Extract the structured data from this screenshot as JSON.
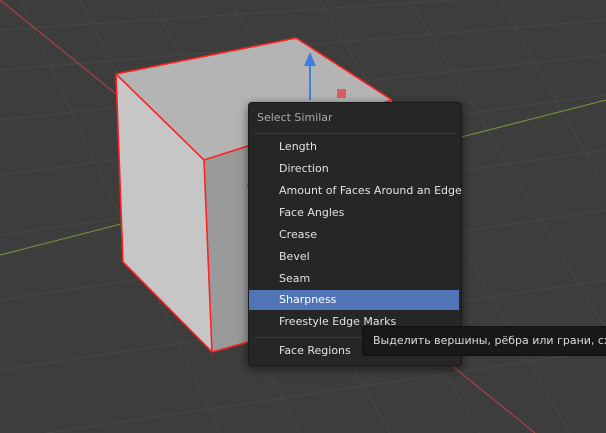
{
  "menu": {
    "title": "Select Similar",
    "items": [
      {
        "label": "Length"
      },
      {
        "label": "Direction"
      },
      {
        "label": "Amount of Faces Around an Edge"
      },
      {
        "label": "Face Angles"
      },
      {
        "label": "Crease"
      },
      {
        "label": "Bevel"
      },
      {
        "label": "Seam"
      },
      {
        "label": "Sharpness",
        "active": true
      },
      {
        "label": "Freestyle Edge Marks"
      },
      {
        "label": "Face Regions"
      }
    ]
  },
  "tooltip": {
    "text": "Выделить вершины, рёбра или грани, схож"
  },
  "colors": {
    "viewport_bg": "#3d3d3d",
    "grid": "#474747",
    "axis_x": "#c0404a",
    "axis_y": "#7a9a35",
    "cube_face": "#9a9a9a",
    "selection_edge": "#ff2020",
    "gizmo_arrow": "#3d7fe0",
    "menu_bg": "#262626",
    "menu_highlight": "#5074b5"
  }
}
